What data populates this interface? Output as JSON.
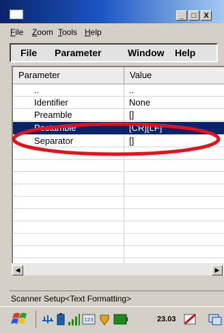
{
  "window": {
    "minimize": "_",
    "maximize": "□",
    "close": "X"
  },
  "menubar": [
    {
      "label": "File"
    },
    {
      "label": "Zoom"
    },
    {
      "label": "Tools"
    },
    {
      "label": "Help"
    }
  ],
  "app_menu": [
    {
      "label": "File"
    },
    {
      "label": "Parameter"
    },
    {
      "label": "Window"
    },
    {
      "label": "Help"
    }
  ],
  "grid": {
    "headers": [
      "Parameter",
      "Value"
    ],
    "rows": [
      {
        "parameter": "..",
        "value": ".."
      },
      {
        "parameter": "Identifier",
        "value": "None"
      },
      {
        "parameter": "Preamble",
        "value": "[]"
      },
      {
        "parameter": "Postamble",
        "value": "[CR][LF]",
        "selected": true
      },
      {
        "parameter": "Separator",
        "value": "[]"
      }
    ]
  },
  "status_text": "Scanner Setup<Text Formatting>",
  "taskbar": {
    "clock": "23.03"
  },
  "colors": {
    "selection": "#0a246a",
    "annotation": "#e8101a",
    "title_gradient_start": "#0a246a"
  }
}
